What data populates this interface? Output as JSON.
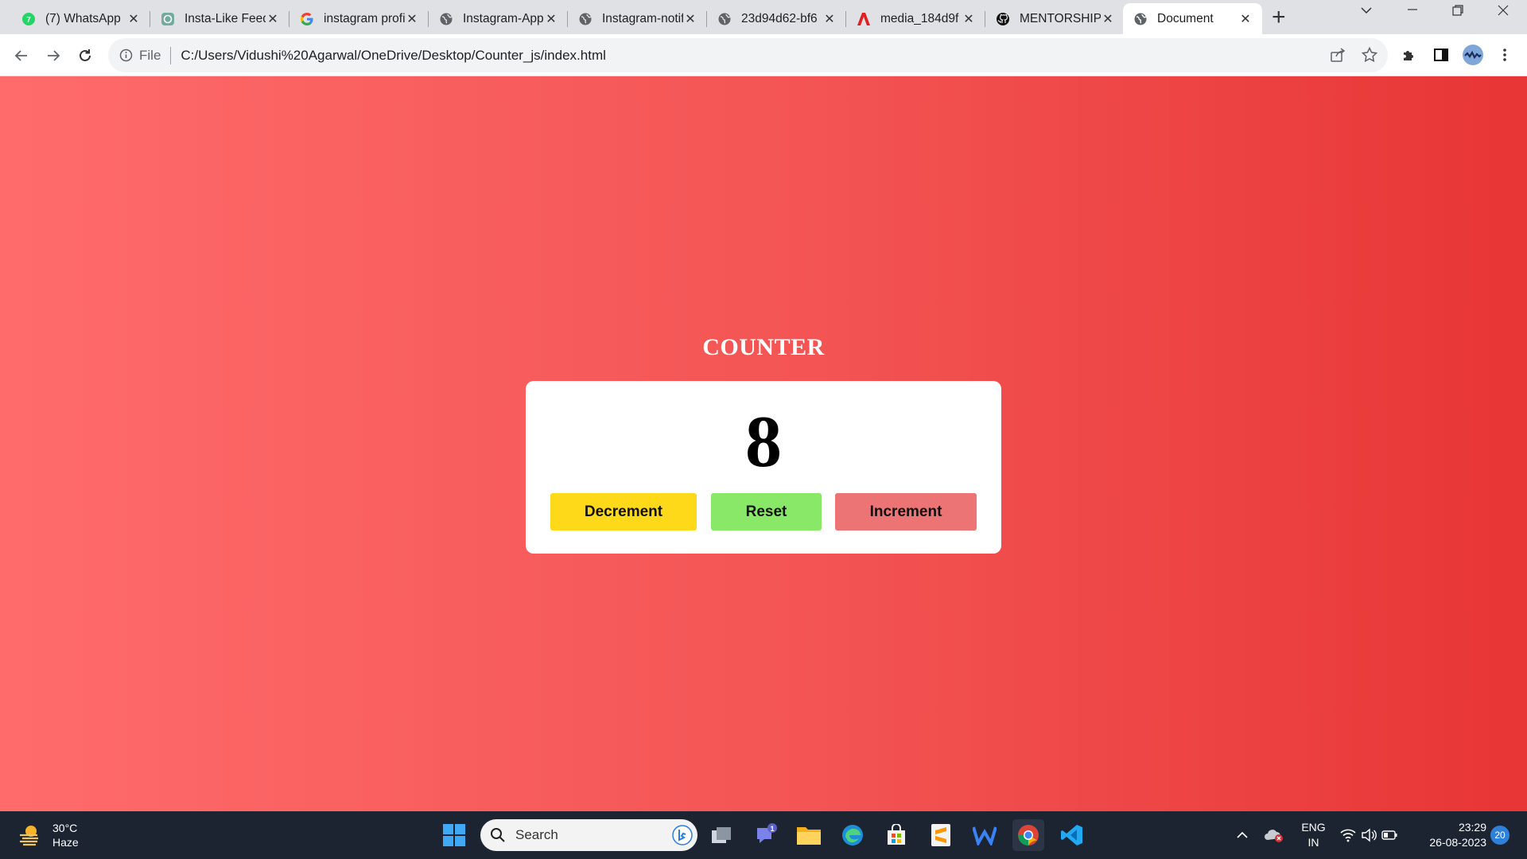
{
  "browser": {
    "tabs": [
      {
        "title": "(7) WhatsApp",
        "icon": "whatsapp-icon",
        "active": false
      },
      {
        "title": "Insta-Like Feed",
        "icon": "chatgpt-icon",
        "active": false
      },
      {
        "title": "instagram profile",
        "icon": "google-icon",
        "active": false
      },
      {
        "title": "Instagram-App",
        "icon": "globe-icon",
        "active": false
      },
      {
        "title": "Instagram-notifications",
        "icon": "globe-icon",
        "active": false
      },
      {
        "title": "23d94d62-bf6",
        "icon": "globe-icon",
        "active": false
      },
      {
        "title": "media_184d9f",
        "icon": "adobe-acrobat-icon",
        "active": false
      },
      {
        "title": "MENTORSHIP",
        "icon": "github-icon",
        "active": false
      },
      {
        "title": "Document",
        "icon": "globe-icon",
        "active": true
      }
    ],
    "address": {
      "scheme_label": "File",
      "url": "C:/Users/Vidushi%20Agarwal/OneDrive/Desktop/Counter_js/index.html"
    }
  },
  "page": {
    "heading": "COUNTER",
    "count": "8",
    "buttons": {
      "decrement": "Decrement",
      "reset": "Reset",
      "increment": "Increment"
    },
    "colors": {
      "decrement": "#fdd91a",
      "reset": "#89e868",
      "increment": "#ec7474"
    }
  },
  "taskbar": {
    "weather": {
      "temp": "30°C",
      "condition": "Haze"
    },
    "search_placeholder": "Search",
    "teams_badge": "1",
    "language": {
      "line1": "ENG",
      "line2": "IN"
    },
    "clock": {
      "time": "23:29",
      "date": "26-08-2023"
    },
    "notification_count": "20"
  }
}
